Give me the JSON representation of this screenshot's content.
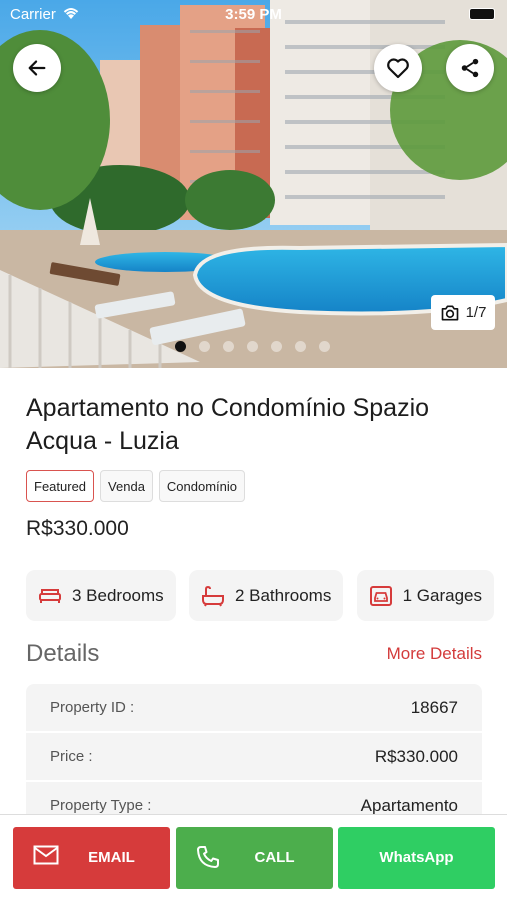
{
  "status_bar": {
    "carrier": "Carrier",
    "time": "3:59 PM"
  },
  "hero": {
    "photo_counter": "1/7",
    "slide_count": 7,
    "active_slide": 0
  },
  "listing": {
    "title": "Apartamento no Condomínio Spazio Acqua - Luzia",
    "tags": [
      "Featured",
      "Venda",
      "Condomínio"
    ],
    "price": "R$330.000"
  },
  "features": [
    {
      "icon": "bed-icon",
      "label": "3 Bedrooms"
    },
    {
      "icon": "bathtub-icon",
      "label": "2 Bathrooms"
    },
    {
      "icon": "garage-icon",
      "label": "1 Garages"
    }
  ],
  "details": {
    "title": "Details",
    "more_label": "More Details",
    "rows": [
      {
        "key": "Property ID :",
        "value": "18667"
      },
      {
        "key": "Price :",
        "value": "R$330.000"
      },
      {
        "key": "Property Type :",
        "value": "Apartamento"
      }
    ]
  },
  "actions": {
    "email": "EMAIL",
    "call": "CALL",
    "whatsapp": "WhatsApp"
  },
  "colors": {
    "accent_red": "#d63b3b",
    "call_green": "#4cae4c",
    "whatsapp_green": "#2fce63"
  }
}
